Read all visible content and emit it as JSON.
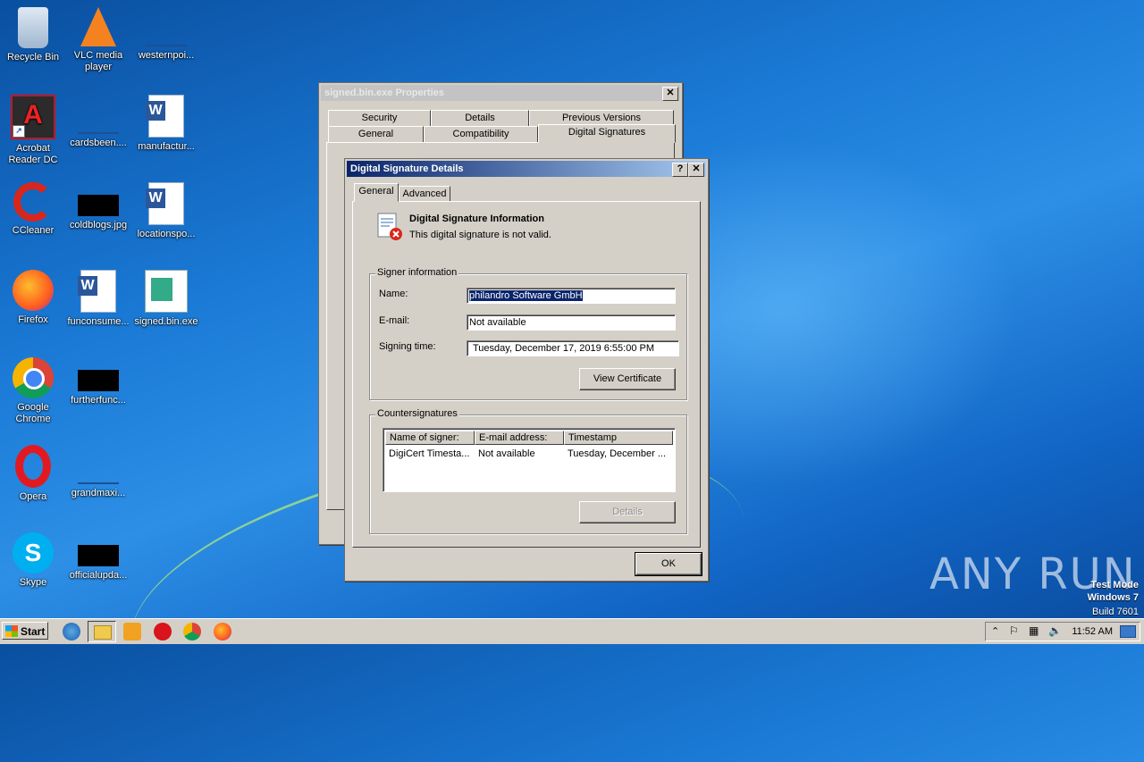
{
  "desktop_icons": [
    {
      "label": "Recycle Bin",
      "icon": "recycle-bin-icon"
    },
    {
      "label": "VLC media player",
      "icon": "vlc-icon"
    },
    {
      "label": "westernpoi...",
      "icon": "file-icon"
    },
    {
      "label": "Acrobat Reader DC",
      "icon": "acrobat-icon"
    },
    {
      "label": "cardsbeen....",
      "icon": "file-icon"
    },
    {
      "label": "manufactur...",
      "icon": "word-doc-icon"
    },
    {
      "label": "CCleaner",
      "icon": "ccleaner-icon"
    },
    {
      "label": "coldblogs.jpg",
      "icon": "image-file-icon"
    },
    {
      "label": "locationspo...",
      "icon": "word-doc-icon"
    },
    {
      "label": "Firefox",
      "icon": "firefox-icon"
    },
    {
      "label": "funconsume...",
      "icon": "word-doc-icon"
    },
    {
      "label": "signed.bin.exe",
      "icon": "exe-icon"
    },
    {
      "label": "Google Chrome",
      "icon": "chrome-icon"
    },
    {
      "label": "furtherfunc...",
      "icon": "image-file-icon"
    },
    {
      "label": "Opera",
      "icon": "opera-icon"
    },
    {
      "label": "grandmaxi...",
      "icon": "file-icon"
    },
    {
      "label": "Skype",
      "icon": "skype-icon"
    },
    {
      "label": "officialupda...",
      "icon": "image-file-icon"
    }
  ],
  "properties_window": {
    "title": "signed.bin.exe Properties",
    "tabs_row1": [
      "Security",
      "Details",
      "Previous Versions"
    ],
    "tabs_row2": [
      "General",
      "Compatibility",
      "Digital Signatures"
    ],
    "selected_tab": "Digital Signatures"
  },
  "dialog": {
    "title": "Digital Signature Details",
    "help_btn": "?",
    "close_btn": "✕",
    "tabs": [
      "General",
      "Advanced"
    ],
    "info_heading": "Digital Signature Information",
    "info_text": "This digital signature is not valid.",
    "signer_group": "Signer information",
    "name_label": "Name:",
    "name_value": "philandro Software GmbH",
    "email_label": "E-mail:",
    "email_value": "Not available",
    "time_label": "Signing time:",
    "time_value": "Tuesday,  December  17,  2019 6:55:00 PM",
    "view_cert_btn": "View Certificate",
    "counter_group": "Countersignatures",
    "columns": [
      "Name of signer:",
      "E-mail address:",
      "Timestamp"
    ],
    "rows": [
      [
        "DigiCert Timesta...",
        "Not available",
        "Tuesday, December ..."
      ]
    ],
    "details_btn": "Details",
    "ok_btn": "OK"
  },
  "taskbar": {
    "start_label": "Start",
    "clock": "11:52 AM"
  },
  "watermark": {
    "line1": "Test Mode",
    "line2": "Windows 7",
    "line3": "Build 7601",
    "brand": "ANY RUN"
  }
}
